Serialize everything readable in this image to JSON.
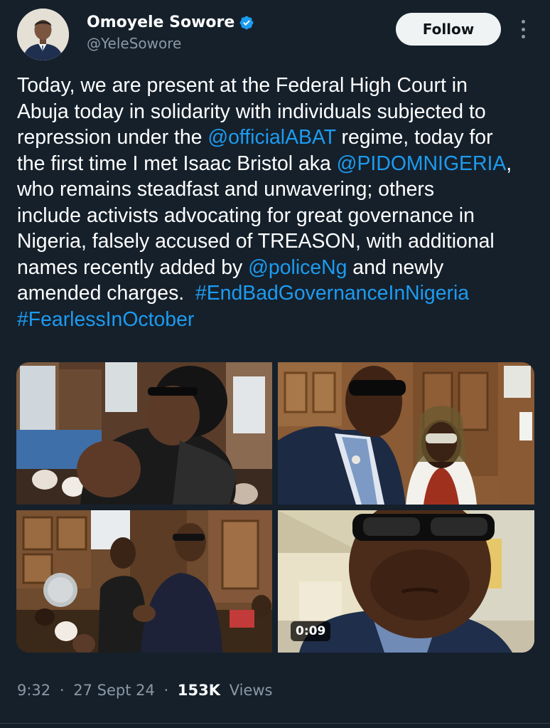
{
  "author": {
    "display_name": "Omoyele Sowore",
    "handle": "@YeleSowore",
    "verified": true,
    "verified_color": "#1d9bf0"
  },
  "follow_label": "Follow",
  "tweet": {
    "lines": [
      [
        {
          "t": "Today, we are present at the Federal High Court in",
          "k": "text"
        }
      ],
      [
        {
          "t": "Abuja today in solidarity with individuals subjected to",
          "k": "text"
        }
      ],
      [
        {
          "t": "repression under the ",
          "k": "text"
        },
        {
          "t": "@officialABAT",
          "k": "mention"
        },
        {
          "t": " regime, today for",
          "k": "text"
        }
      ],
      [
        {
          "t": "the first time I met Isaac Bristol aka ",
          "k": "text"
        },
        {
          "t": "@PIDOMNIGERIA",
          "k": "mention"
        },
        {
          "t": ",",
          "k": "text"
        }
      ],
      [
        {
          "t": "who remains steadfast and unwavering; others",
          "k": "text"
        }
      ],
      [
        {
          "t": "include activists advocating for great governance in",
          "k": "text"
        }
      ],
      [
        {
          "t": "Nigeria, falsely accused of TREASON, with additional",
          "k": "text"
        }
      ],
      [
        {
          "t": "names recently added by ",
          "k": "text"
        },
        {
          "t": "@policeNg",
          "k": "mention"
        },
        {
          "t": " and newly",
          "k": "text"
        }
      ],
      [
        {
          "t": "amended charges.  ",
          "k": "text"
        },
        {
          "t": "#EndBadGovernanceInNigeria",
          "k": "hashtag"
        }
      ],
      [
        {
          "t": "#FearlessInOctober",
          "k": "hashtag"
        }
      ]
    ]
  },
  "media": {
    "video_duration": "0:09"
  },
  "meta": {
    "time": "9:32",
    "separator": "·",
    "date": "27 Sept 24",
    "views_count": "153K",
    "views_label": "Views"
  },
  "colors": {
    "background": "#15202b",
    "link": "#1d9bf0",
    "secondary_text": "#8b98a5",
    "divider": "#38444d"
  },
  "icons": [
    "verified-badge-icon",
    "more-options-icon"
  ]
}
